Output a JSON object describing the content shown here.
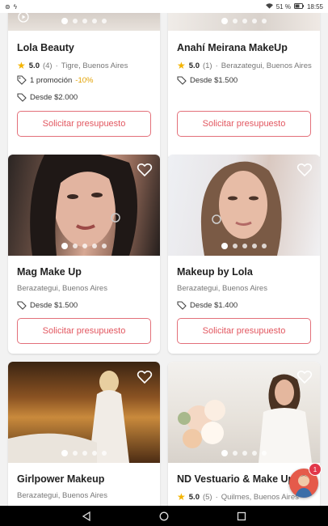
{
  "status_bar": {
    "battery": "51 %",
    "time": "18:55"
  },
  "cards": [
    {
      "name": "Lola Beauty",
      "rating": "5.0",
      "reviews": "(4)",
      "location": "Tigre, Buenos Aires",
      "promo_label": "1 promoción",
      "promo_pct": "-10%",
      "price": "Desde $2.000",
      "cta": "Solicitar presupuesto"
    },
    {
      "name": "Anahí Meirana MakeUp",
      "rating": "5.0",
      "reviews": "(1)",
      "location": "Berazategui, Buenos Aires",
      "price": "Desde $1.500",
      "cta": "Solicitar presupuesto"
    },
    {
      "name": "Mag Make Up",
      "location": "Berazategui, Buenos Aires",
      "price": "Desde $1.500",
      "cta": "Solicitar presupuesto"
    },
    {
      "name": "Makeup by Lola",
      "location": "Berazategui, Buenos Aires",
      "price": "Desde $1.400",
      "cta": "Solicitar presupuesto"
    },
    {
      "name": "Girlpower Makeup",
      "location": "Berazategui, Buenos Aires"
    },
    {
      "name": "ND Vestuario & Make Up",
      "rating": "5.0",
      "reviews": "(5)",
      "location": "Quilmes, Buenos Aires"
    }
  ],
  "chat_badge": "1",
  "icons": {
    "heart": "heart-icon",
    "star": "star-icon",
    "tag": "tag-icon",
    "promo": "promo-tag-icon"
  }
}
